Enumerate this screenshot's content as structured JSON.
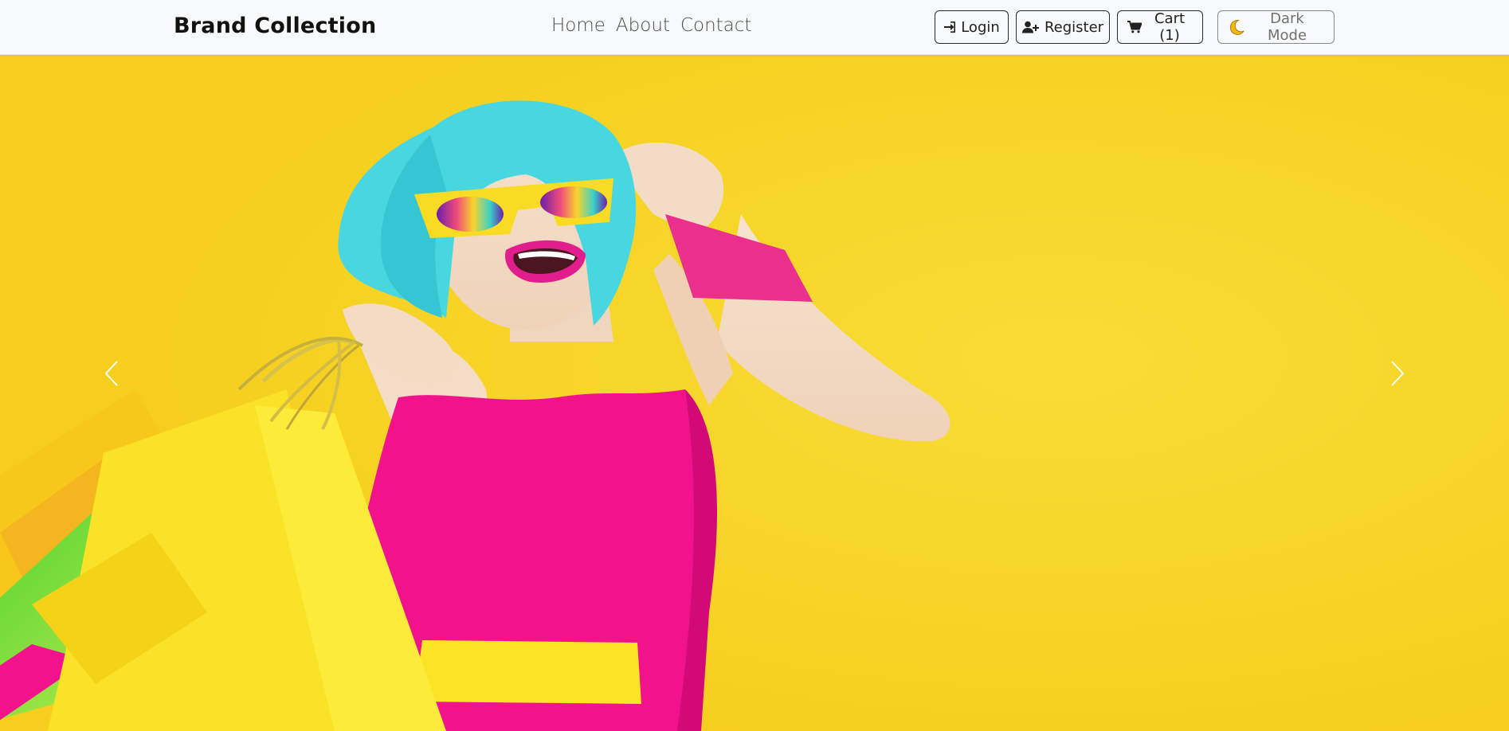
{
  "navbar": {
    "brand": "Brand Collection",
    "links": [
      {
        "label": "Home"
      },
      {
        "label": "About"
      },
      {
        "label": "Contact"
      }
    ],
    "buttons": {
      "login": {
        "label": "Login",
        "icon": "sign-in-icon"
      },
      "register": {
        "label": "Register",
        "icon": "user-plus-icon"
      },
      "cart": {
        "label": "Cart (1)",
        "icon": "shopping-cart-icon"
      },
      "dark_mode": {
        "label": "Dark Mode",
        "icon": "moon-icon"
      }
    }
  },
  "hero": {
    "image": "woman-with-shopping-bags",
    "colors": {
      "background": "#f6cf1f",
      "dress": "#f2138c",
      "hair": "#48d6e0",
      "bags": "#fbe31c"
    }
  },
  "carousel": {
    "prev_icon": "chevron-left-icon",
    "next_icon": "chevron-right-icon"
  }
}
